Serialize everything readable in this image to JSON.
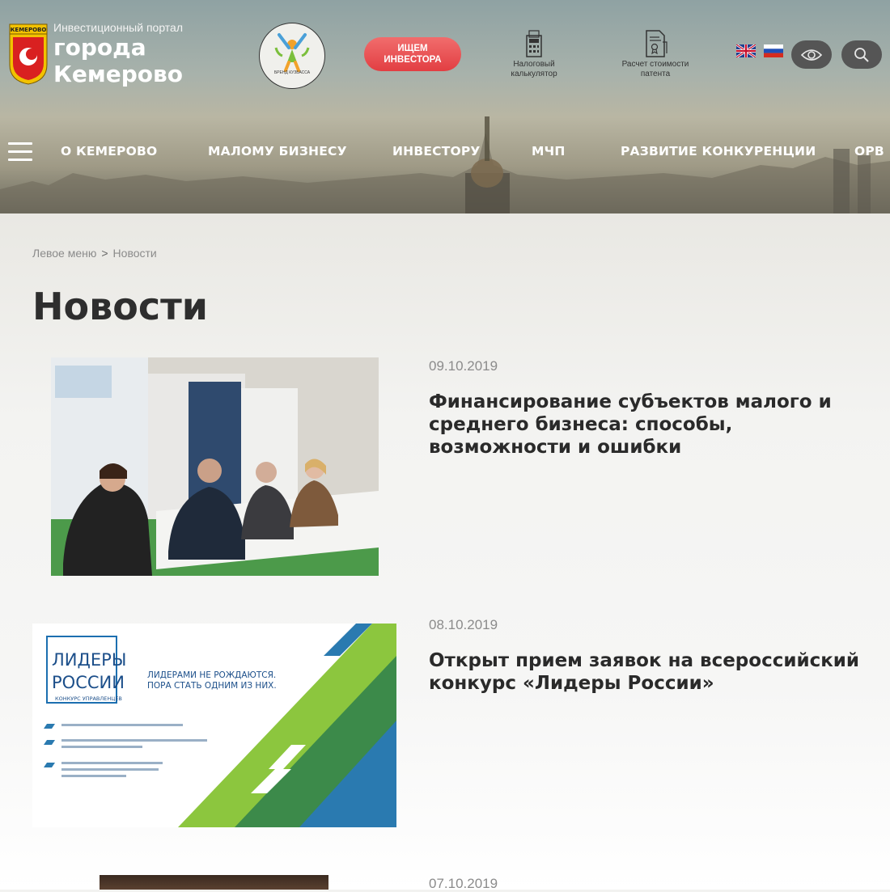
{
  "header": {
    "portal_subtitle": "Инвестиционный портал",
    "portal_city": "города Кемерово",
    "emblem_text": "КЕМЕРОВО",
    "brand_label": "БРЕНД КУЗБАССА",
    "invest_button": "ИЩЕМ ИНВЕСТОРА",
    "tools": [
      {
        "label": "Налоговый калькулятор",
        "icon": "calculator-icon"
      },
      {
        "label": "Расчет стоимости патента",
        "icon": "patent-document-icon"
      }
    ],
    "languages": [
      "en",
      "ru"
    ]
  },
  "nav": {
    "items": [
      "О КЕМЕРОВО",
      "МАЛОМУ БИЗНЕСУ",
      "ИНВЕСТОРУ",
      "МЧП",
      "РАЗВИТИЕ КОНКУРЕНЦИИ",
      "ОРВ"
    ]
  },
  "breadcrumb": {
    "items": [
      "Левое меню",
      "Новости"
    ],
    "separator": ">"
  },
  "page_title": "Новости",
  "news": [
    {
      "date": "09.10.2019",
      "title": "Финансирование субъектов малого и среднего бизнеса: способы, возможности и ошибки"
    },
    {
      "date": "08.10.2019",
      "title": "Открыт прием заявок на всероссийский конкурс «Лидеры России»",
      "image_text": {
        "logo_line1": "ЛИДЕРЫ",
        "logo_line2": "РОССИИ",
        "logo_sub": "КОНКУРС УПРАВЛЕНЦЕВ",
        "slogan": "ЛИДЕРАМИ НЕ РОЖДАЮТСЯ. ПОРА СТАТЬ ОДНИМ ИЗ НИХ."
      }
    },
    {
      "date": "07.10.2019",
      "title": ""
    }
  ],
  "colors": {
    "invest_button": "#e8464a",
    "nav_text": "#ffffff",
    "title_text": "#2e2e2e",
    "date_text": "#8b8b8b"
  }
}
